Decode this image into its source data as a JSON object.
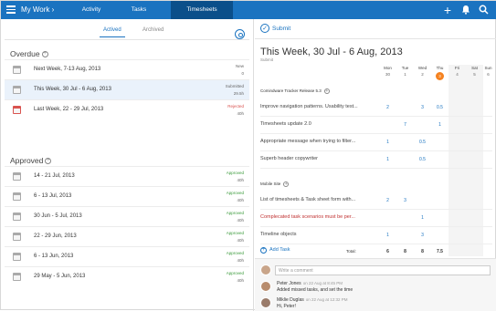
{
  "topbar": {
    "brand": "My Work",
    "brand_arrow": "›",
    "nav": [
      {
        "label": "Activity",
        "active": false
      },
      {
        "label": "Tasks",
        "active": false
      },
      {
        "label": "Timesheets",
        "active": true
      }
    ],
    "icons": [
      "plus-icon",
      "bell-icon",
      "search-icon"
    ]
  },
  "left": {
    "tabs": [
      "Actived",
      "Archived"
    ],
    "overdue_label": "Overdue",
    "overdue": [
      {
        "title": "Next Week, 7-13 Aug, 2013",
        "status": "New",
        "hours": "0",
        "status_type": "new",
        "selected": false,
        "icon": "gray"
      },
      {
        "title": "This Week, 30 Jul - 6 Aug, 2013",
        "status": "Submitted",
        "hours": "29.5h",
        "status_type": "submitted",
        "selected": true,
        "icon": "gray"
      },
      {
        "title": "Last Week, 22 - 29 Jul, 2013",
        "status": "Rejected",
        "hours": "40h",
        "status_type": "rejected",
        "selected": false,
        "icon": "red"
      }
    ],
    "approved_label": "Approved",
    "approved": [
      {
        "title": "14 - 21 Jul, 2013",
        "status": "Approved",
        "hours": "40h"
      },
      {
        "title": "6 - 13 Jul, 2013",
        "status": "Approved",
        "hours": "40h"
      },
      {
        "title": "30 Jun - 5 Jul, 2013",
        "status": "Approved",
        "hours": "40h"
      },
      {
        "title": "22 - 29 Jun, 2013",
        "status": "Approved",
        "hours": "40h"
      },
      {
        "title": "6 - 13 Jun, 2013",
        "status": "Approved",
        "hours": "40h"
      },
      {
        "title": "29 May - 5 Jun, 2013",
        "status": "Approved",
        "hours": "40h"
      }
    ]
  },
  "right": {
    "submit_label": "Submit",
    "week_title": "This Week, 30 Jul - 6 Aug, 2013",
    "week_sub": "Submit",
    "days": [
      {
        "name": "Mon",
        "num": "30"
      },
      {
        "name": "Tue",
        "num": "1"
      },
      {
        "name": "Wed",
        "num": "2"
      },
      {
        "name": "Thu",
        "num": "3",
        "today": true
      },
      {
        "name": "Fri",
        "num": "4"
      },
      {
        "name": "Sat",
        "num": "5"
      },
      {
        "name": "Sun",
        "num": "6"
      }
    ],
    "groups": [
      {
        "name": "Comindware Tracker Release 5.3",
        "tasks": [
          {
            "name": "Improve navigation patterns. Usability test...",
            "cells": [
              "2",
              "",
              "3",
              "0.5",
              "",
              "",
              ""
            ],
            "red": false
          },
          {
            "name": "Timesheets update 2.0",
            "cells": [
              "",
              "7",
              "",
              "1",
              "",
              "",
              ""
            ],
            "red": false
          },
          {
            "name": "Appropriate message when trying to filter...",
            "cells": [
              "1",
              "",
              "0.5",
              "",
              "",
              "",
              ""
            ],
            "red": false
          },
          {
            "name": "Superb header copywriter",
            "cells": [
              "1",
              "",
              "0.5",
              "",
              "",
              "",
              ""
            ],
            "red": false
          }
        ]
      },
      {
        "name": "Mobile Site",
        "tasks": [
          {
            "name": "List of timesheets & Task sheet form with...",
            "cells": [
              "2",
              "3",
              "",
              "",
              "",
              "",
              ""
            ],
            "red": false
          },
          {
            "name": "Complecated task scenarios must be per...",
            "cells": [
              "",
              "",
              "1",
              "",
              "",
              "",
              ""
            ],
            "red": true
          },
          {
            "name": "Timeline objects",
            "cells": [
              "1",
              "",
              "3",
              "",
              "",
              "",
              ""
            ],
            "red": false
          }
        ]
      }
    ],
    "add_task": "Add Task",
    "total_label": "Total:",
    "totals": [
      "6",
      "8",
      "8",
      "7.5",
      "",
      "",
      ""
    ],
    "comment_placeholder": "Write a comment",
    "comments": [
      {
        "name": "Peter Jones",
        "time": "on 22 Aug at 8:45 PM",
        "text": "Added missed tasks, and set the time"
      },
      {
        "name": "Miklie Duglas",
        "time": "on 22 Aug at 12:32 PM",
        "text": "Hi, Peter!"
      }
    ]
  }
}
